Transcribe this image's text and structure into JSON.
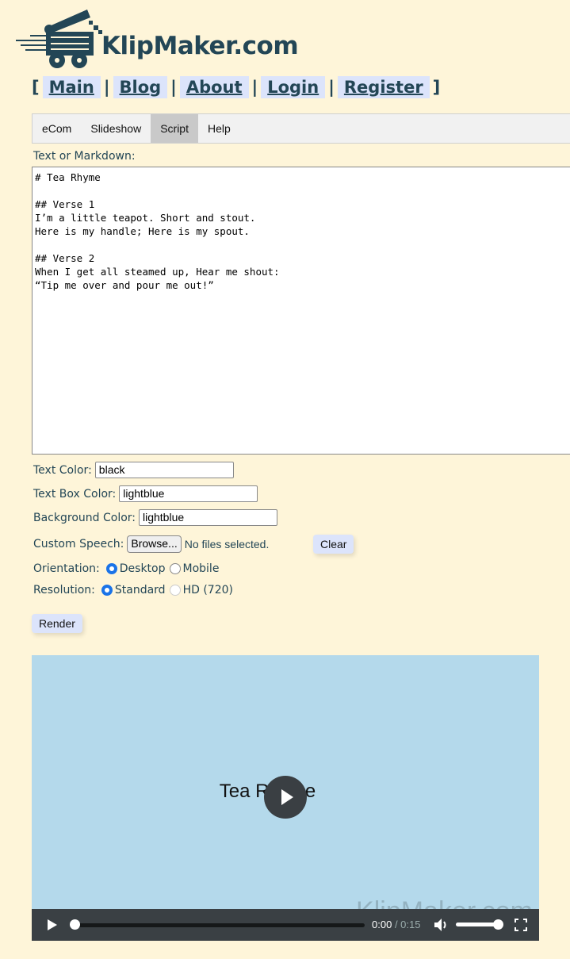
{
  "brand": {
    "name": "KlipMaker.com"
  },
  "nav": {
    "items": [
      "Main",
      "Blog",
      "About",
      "Login",
      "Register"
    ]
  },
  "tabs": [
    {
      "label": "eCom"
    },
    {
      "label": "Slideshow"
    },
    {
      "label": "Script",
      "active": true
    },
    {
      "label": "Help"
    }
  ],
  "form": {
    "script_label": "Text or Markdown:",
    "script_value": "# Tea Rhyme\n\n## Verse 1\nI’m a little teapot. Short and stout.\nHere is my handle; Here is my spout.\n\n## Verse 2\nWhen I get all steamed up, Hear me shout:\n“Tip me over and pour me out!”",
    "text_color_label": "Text Color:",
    "text_color": "black",
    "text_box_color_label": "Text Box Color:",
    "text_box_color": "lightblue",
    "bg_color_label": "Background Color:",
    "bg_color": "lightblue",
    "speech_label": "Custom Speech:",
    "browse": "Browse...",
    "no_files": "No files selected.",
    "clear": "Clear",
    "orientation_label": "Orientation:",
    "orientation_options": [
      "Desktop",
      "Mobile"
    ],
    "orientation_selected": "Desktop",
    "resolution_label": "Resolution:",
    "resolution_options": [
      "Standard",
      "HD (720)"
    ],
    "resolution_selected": "Standard",
    "render": "Render"
  },
  "video": {
    "title": "Tea Rhyme",
    "watermark": "KlipMaker.com",
    "current": "0:00",
    "duration": "/ 0:15",
    "progress": 0,
    "volume": 1.0,
    "background": "#b4d9eb"
  },
  "colors": {
    "page_bg": "#fef5d9",
    "text": "#234656",
    "accent": "#dce4fb"
  }
}
